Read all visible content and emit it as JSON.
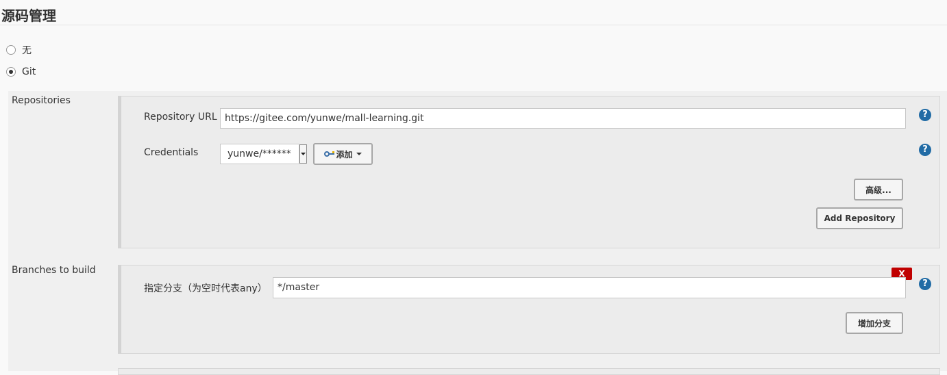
{
  "section": {
    "title": "源码管理"
  },
  "scm_options": [
    {
      "label": "无",
      "checked": false
    },
    {
      "label": "Git",
      "checked": true
    }
  ],
  "repositories": {
    "label": "Repositories",
    "url_label": "Repository URL",
    "url_value": "https://gitee.com/yunwe/mall-learning.git",
    "credentials_label": "Credentials",
    "credentials_value": "yunwe/******",
    "add_button": "添加",
    "advanced_button": "高级...",
    "add_repository_button": "Add Repository",
    "help": "?"
  },
  "branches": {
    "label": "Branches to build",
    "branch_label": "指定分支（为空时代表any）",
    "branch_value": "*/master",
    "delete_label": "X",
    "add_branch_button": "增加分支",
    "help": "?"
  }
}
